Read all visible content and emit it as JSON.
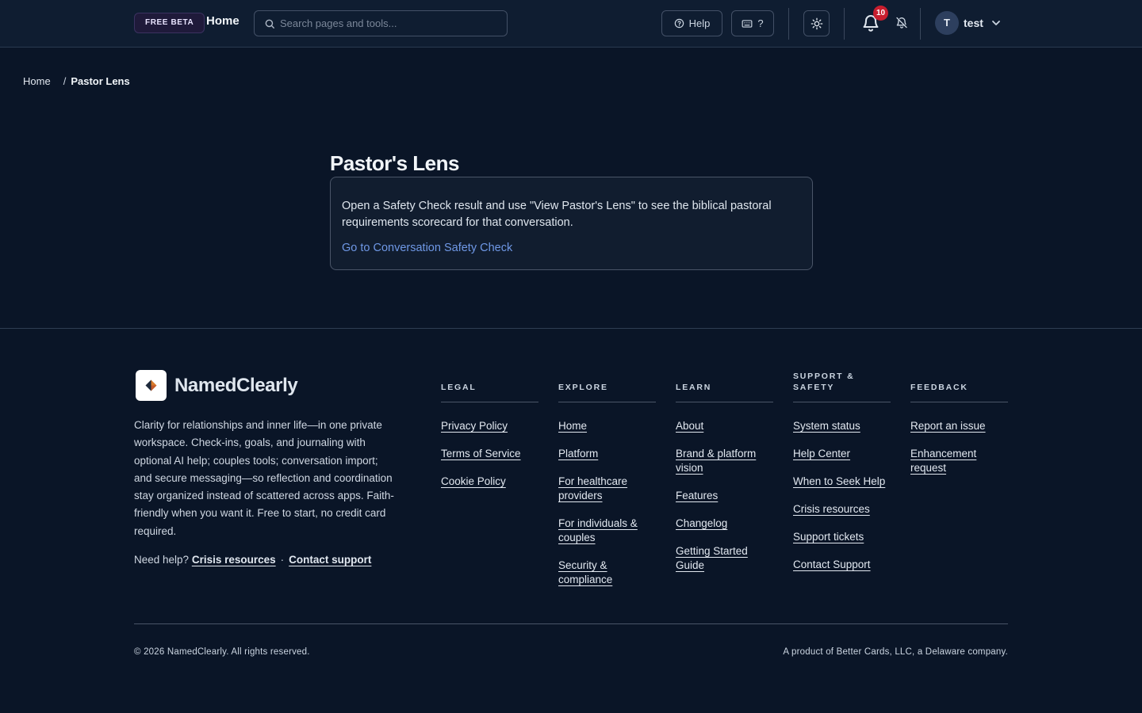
{
  "header": {
    "beta_badge": "FREE BETA",
    "title": "Home",
    "search_placeholder": "Search pages and tools...",
    "help_label": "Help",
    "shortcuts_label": "?",
    "notifications_count": "10",
    "user_initial": "T",
    "user_name": "test"
  },
  "breadcrumb": {
    "home": "Home",
    "separator": "/",
    "current": "Pastor Lens"
  },
  "main": {
    "title": "Pastor's Lens",
    "card_text": "Open a Safety Check result and use \"View Pastor's Lens\" to see the biblical pastoral requirements scorecard for that conversation.",
    "card_link": "Go to Conversation Safety Check"
  },
  "footer": {
    "brand": "NamedClearly",
    "blurb": "Clarity for relationships and inner life—in one private workspace. Check-ins, goals, and journaling with optional AI help; couples tools; conversation import; and secure messaging—so reflection and coordination stay organized instead of scattered across apps. Faith-friendly when you want it. Free to start, no credit card required.",
    "need_help": "Need help?",
    "crisis_link": "Crisis resources",
    "dot": "·",
    "contact_link": "Contact support",
    "columns": [
      {
        "heading": "LEGAL",
        "links": [
          "Privacy Policy",
          "Terms of Service",
          "Cookie Policy"
        ]
      },
      {
        "heading": "EXPLORE",
        "links": [
          "Home",
          "Platform",
          "For healthcare providers",
          "For individuals & couples",
          "Security & compliance"
        ]
      },
      {
        "heading": "LEARN",
        "links": [
          "About",
          "Brand & platform vision",
          "Features",
          "Changelog",
          "Getting Started Guide"
        ]
      },
      {
        "heading": "SUPPORT & SAFETY",
        "links": [
          "System status",
          "Help Center",
          "When to Seek Help",
          "Crisis resources",
          "Support tickets",
          "Contact Support"
        ]
      },
      {
        "heading": "FEEDBACK",
        "links": [
          "Report an issue",
          "Enhancement request"
        ]
      }
    ],
    "copyright": "© 2026 NamedClearly. All rights reserved.",
    "product_of": "A product of Better Cards, LLC, a Delaware company."
  },
  "colors": {
    "background": "#0a1527",
    "header_bg": "#0f1d31",
    "link_accent": "#6f98e6",
    "badge_red": "#c81e2e"
  },
  "icons": [
    "search-icon",
    "help-circle-icon",
    "keyboard-icon",
    "sun-icon",
    "bell-icon",
    "bell-off-icon",
    "chevron-down-icon",
    "logo-icon"
  ]
}
